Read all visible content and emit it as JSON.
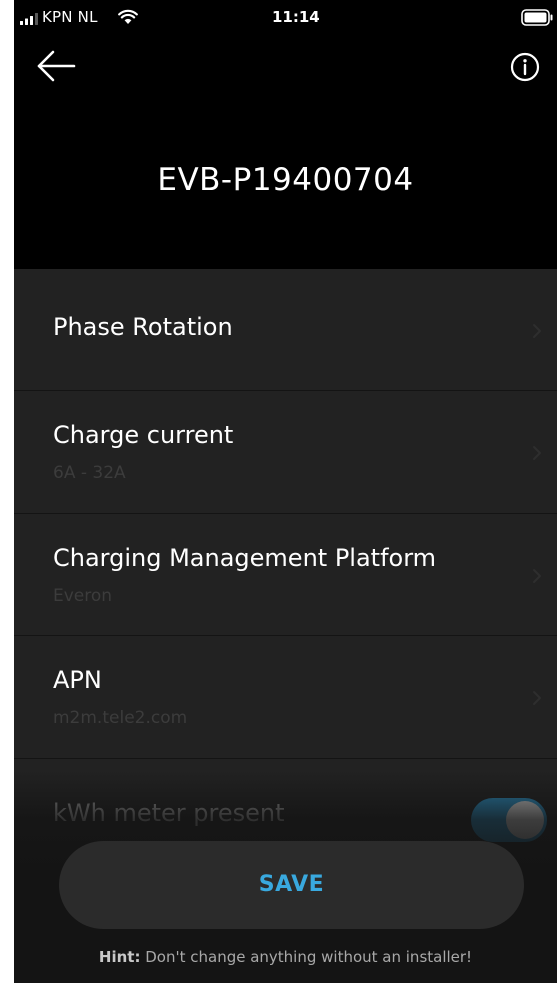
{
  "status_bar": {
    "carrier": "KPN NL",
    "time": "11:14"
  },
  "header": {
    "title": "EVB-P19400704"
  },
  "settings": {
    "items": [
      {
        "label": "Phase Rotation",
        "sublabel": ""
      },
      {
        "label": "Charge current",
        "sublabel": "6A - 32A"
      },
      {
        "label": "Charging Management Platform",
        "sublabel": "Everon"
      },
      {
        "label": "APN",
        "sublabel": "m2m.tele2.com"
      }
    ],
    "kwh_meter": {
      "label": "kWh meter present",
      "enabled": true
    }
  },
  "footer": {
    "save_label": "SAVE",
    "hint_prefix": "Hint:",
    "hint_text": " Don't change anything without an installer!"
  },
  "colors": {
    "accent": "#39a9df",
    "toggle_on": "#2a7faa",
    "background": "#000000",
    "list_background": "#222222"
  },
  "icons": [
    "signal-icon",
    "wifi-icon",
    "battery-icon",
    "back-arrow-icon",
    "info-icon",
    "chevron-right-icon"
  ]
}
